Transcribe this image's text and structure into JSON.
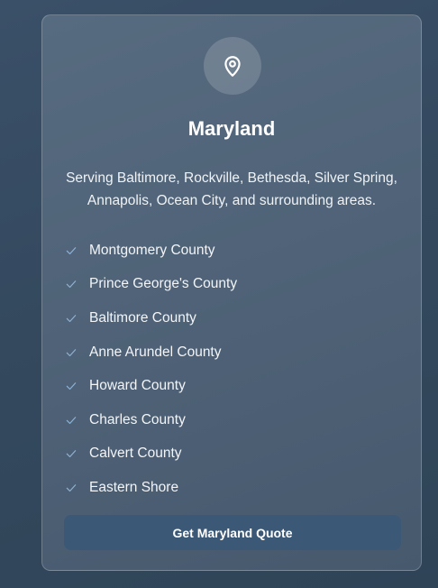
{
  "card": {
    "icon": "map-pin-icon",
    "title": "Maryland",
    "description": "Serving Baltimore, Rockville, Bethesda, Silver Spring, Annapolis, Ocean City, and surrounding areas.",
    "check_icon": "check-icon",
    "check_color": "#8fb3d6",
    "areas": [
      "Montgomery County",
      "Prince George's County",
      "Baltimore County",
      "Anne Arundel County",
      "Howard County",
      "Charles County",
      "Calvert County",
      "Eastern Shore"
    ],
    "cta_label": "Get Maryland Quote"
  },
  "colors": {
    "background": "#34495e",
    "card": "#52667b",
    "button": "#3b5876"
  }
}
